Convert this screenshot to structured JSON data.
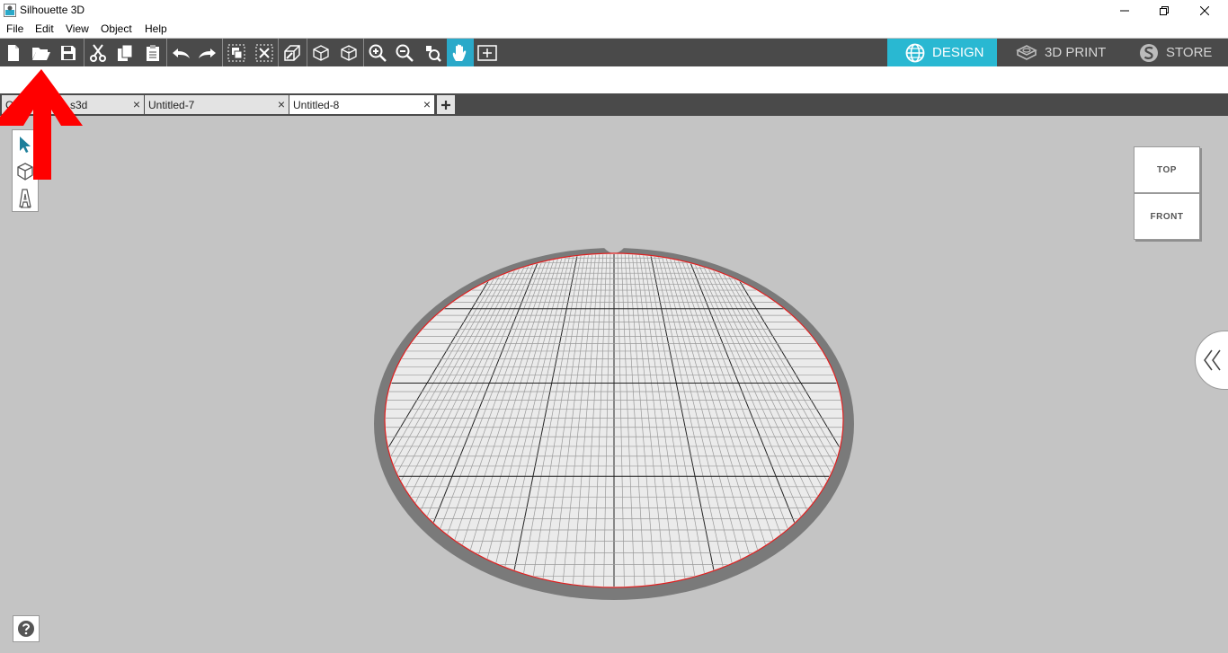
{
  "window": {
    "title": "Silhouette 3D",
    "controls": [
      "minimize",
      "restore",
      "close"
    ]
  },
  "menu": {
    "items": [
      "File",
      "Edit",
      "View",
      "Object",
      "Help"
    ]
  },
  "toolbar": {
    "tools": [
      "new-document-icon",
      "open-folder-icon",
      "save-icon",
      "cut-icon",
      "copy-icon",
      "paste-icon",
      "undo-icon",
      "redo-icon",
      "group-icon",
      "ungroup-icon",
      "extrude-icon",
      "3d-box-icon",
      "3d-box-alt-icon",
      "zoom-in-icon",
      "zoom-out-icon",
      "zoom-fit-icon",
      "pan-hand-icon",
      "fit-to-window-icon"
    ],
    "active_tool": "pan-hand-icon"
  },
  "modes": [
    {
      "label": "DESIGN",
      "icon": "globe-icon",
      "active": true
    },
    {
      "label": "3D PRINT",
      "icon": "printer-3d-icon",
      "active": false
    },
    {
      "label": "STORE",
      "icon": "store-s-icon",
      "active": false
    }
  ],
  "tabs": [
    {
      "label": "Comfortmin...s3d",
      "close": "×",
      "active": false
    },
    {
      "label": "Untitled-7",
      "close": "×",
      "active": false
    },
    {
      "label": "Untitled-8",
      "close": "×",
      "active": true
    }
  ],
  "add_tab": "+",
  "side_tools": [
    "select-arrow-icon",
    "3d-shape-icon",
    "text-icon"
  ],
  "viewcube": {
    "top": "TOP",
    "front": "FRONT"
  },
  "colors": {
    "toolbar_bg": "#4a4a4a",
    "accent": "#29b8d2",
    "canvas_bg": "#c4c4c4",
    "plate_rim": "#7a7a7a",
    "plate_surface": "#ebebeb",
    "plate_edge": "#e02020",
    "annotation_arrow": "#ff0000"
  }
}
